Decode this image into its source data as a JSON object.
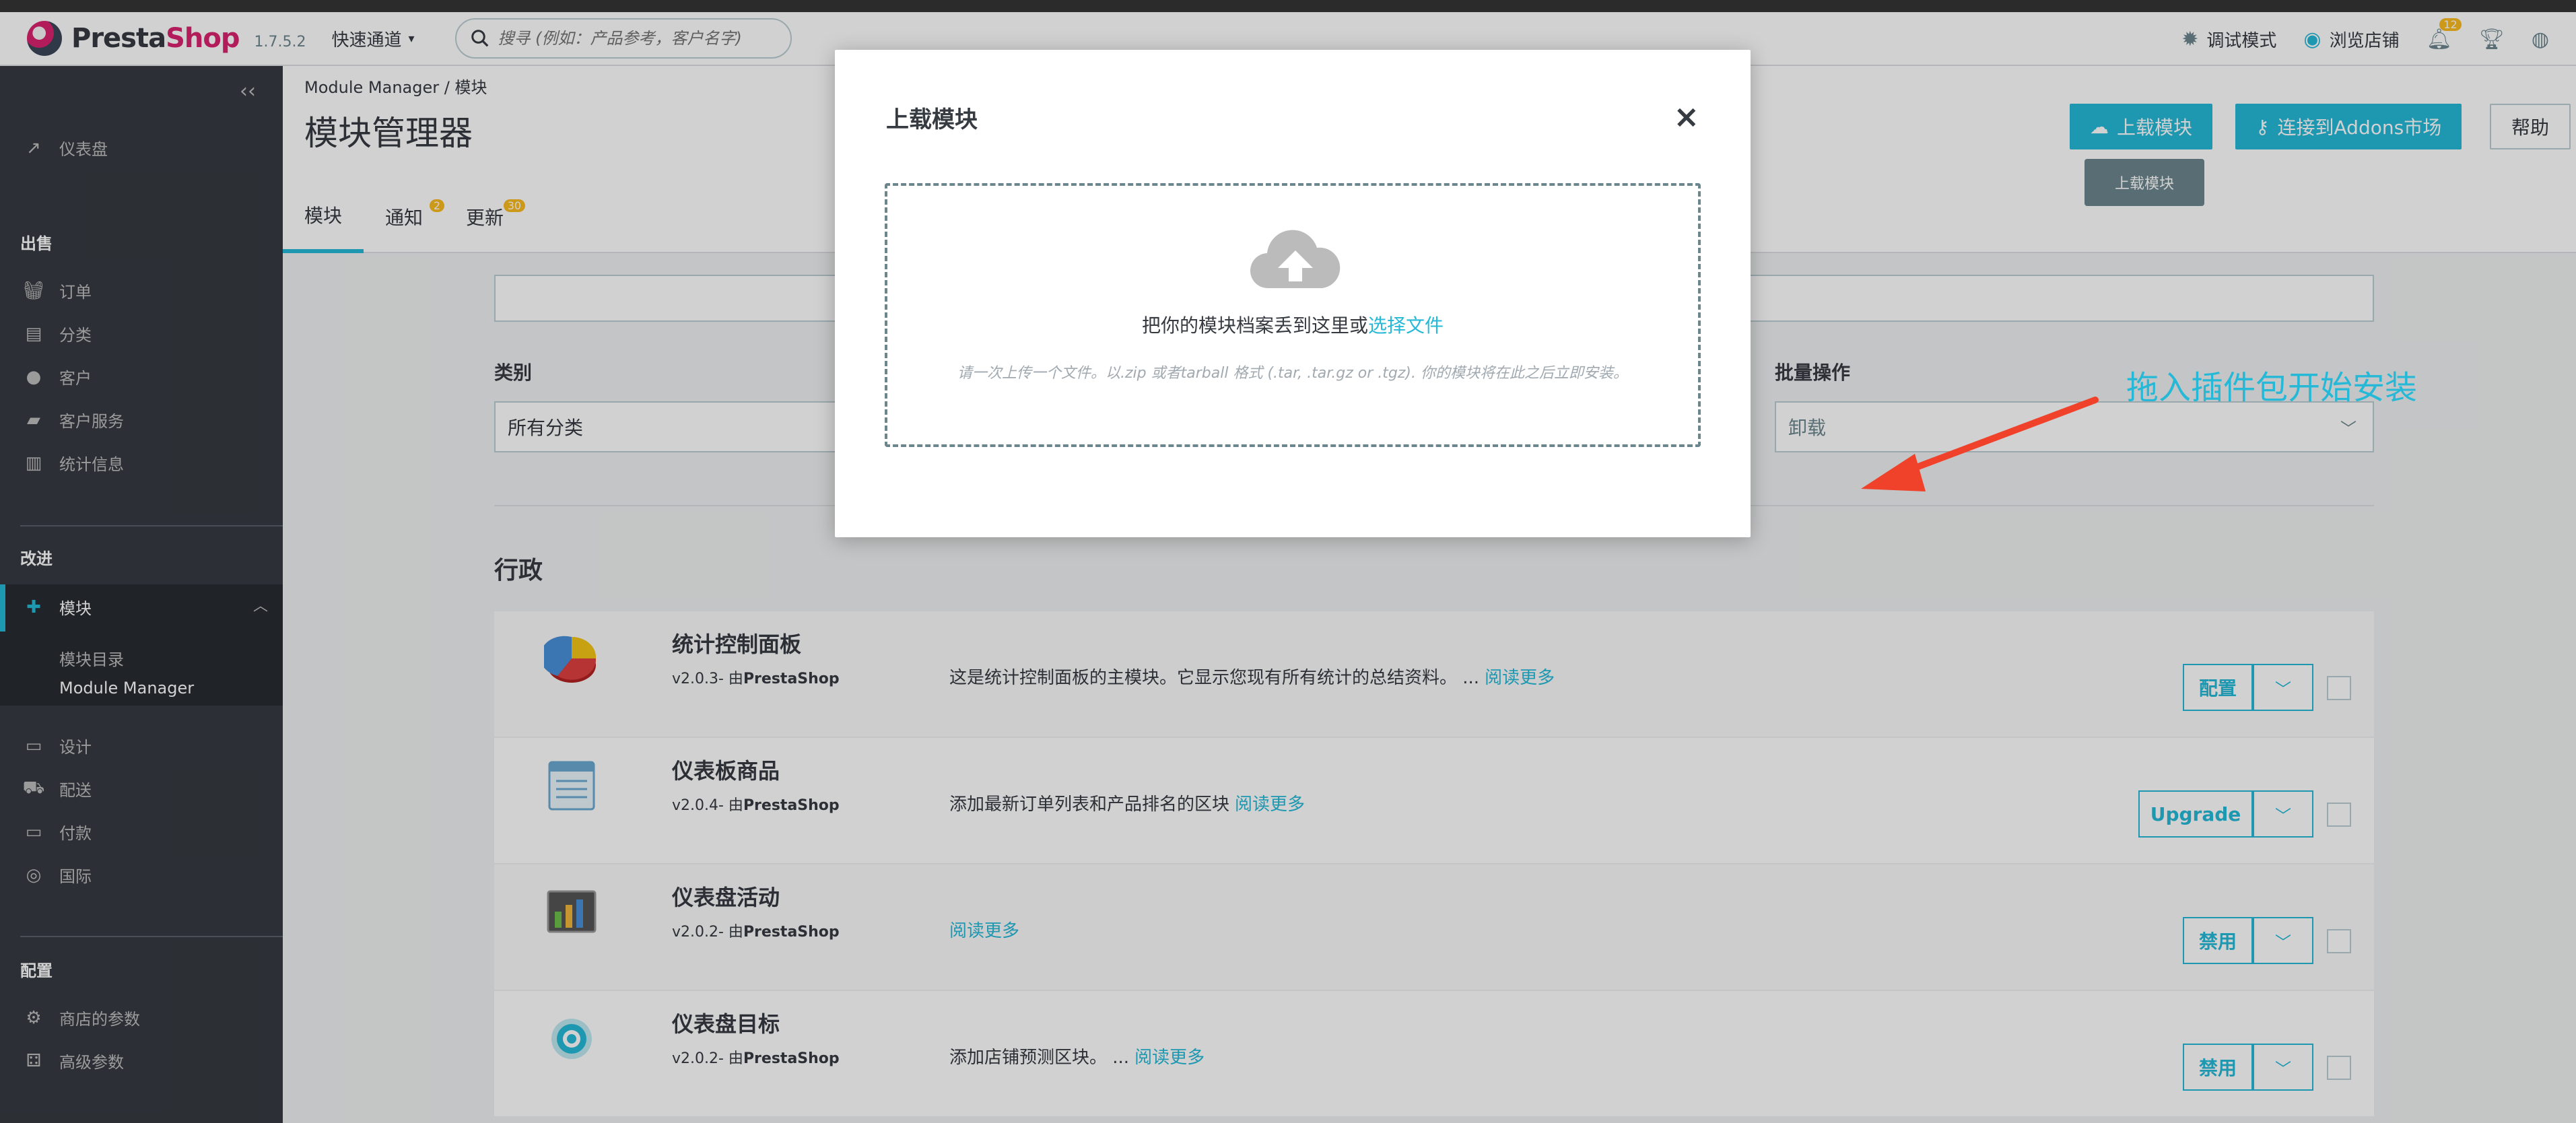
{
  "header": {
    "logo_brand": "Presta",
    "logo_accent": "Shop",
    "version": "1.7.5.2",
    "quick_access": "快速通道",
    "search_placeholder": "搜寻 (例如：产品参考，客户名字)",
    "debug_mode": "调试模式",
    "view_store": "浏览店铺",
    "notification_count": "12"
  },
  "sidebar": {
    "dashboard": "仪表盘",
    "sell_heading": "出售",
    "sell_items": [
      "订单",
      "分类",
      "客户",
      "客户服务",
      "统计信息"
    ],
    "improve_heading": "改进",
    "modules": "模块",
    "module_sub": [
      "模块目录",
      "Module Manager"
    ],
    "improve_items": [
      "设计",
      "配送",
      "付款",
      "国际"
    ],
    "config_heading": "配置",
    "config_items": [
      "商店的参数",
      "高级参数"
    ]
  },
  "page": {
    "breadcrumb": "Module Manager  /  模块",
    "title": "模块管理器",
    "tabs": [
      {
        "label": "模块",
        "badge": ""
      },
      {
        "label": "通知",
        "badge": "2"
      },
      {
        "label": "更新",
        "badge": "30"
      }
    ],
    "upload_button": "上载模块",
    "connect_button": "连接到Addons市场",
    "help_button": "帮助",
    "tooltip": "上载模块"
  },
  "filters": {
    "category_label": "类别",
    "category_value": "所有分类",
    "bulk_label": "批量操作",
    "bulk_value": "卸载"
  },
  "section": {
    "title": "行政"
  },
  "modules": [
    {
      "name": "统计控制面板",
      "version": "v2.0.3- 由",
      "author": "PrestaShop",
      "desc": "这是统计控制面板的主模块。它显示您现有所有统计的总结资料。 ...",
      "link": "阅读更多",
      "action": "配置"
    },
    {
      "name": "仪表板商品",
      "version": "v2.0.4- 由",
      "author": "PrestaShop",
      "desc": "添加最新订单列表和产品排名的区块",
      "link": "阅读更多",
      "action": "Upgrade"
    },
    {
      "name": "仪表盘活动",
      "version": "v2.0.2- 由",
      "author": "PrestaShop",
      "desc": "",
      "link": "阅读更多",
      "action": "禁用"
    },
    {
      "name": "仪表盘目标",
      "version": "v2.0.2- 由",
      "author": "PrestaShop",
      "desc": "添加店铺预测区块。 ...",
      "link": "阅读更多",
      "action": "禁用"
    }
  ],
  "modal": {
    "title": "上载模块",
    "close": "×",
    "drop_text": "把你的模块档案丢到这里或",
    "choose_file": "选择文件",
    "hint": "请一次上传一个文件。以.zip 或者tarball 格式 (.tar, .tar.gz or .tgz). 你的模块将在此之后立即安装。"
  },
  "annotation": {
    "text": "拖入插件包开始安装",
    "color": "#25b9d7",
    "arrow_color": "#f0412a"
  },
  "colors": {
    "accent": "#25b9d7",
    "sidebar_bg": "#363a41",
    "brand_pink": "#d9236e"
  }
}
